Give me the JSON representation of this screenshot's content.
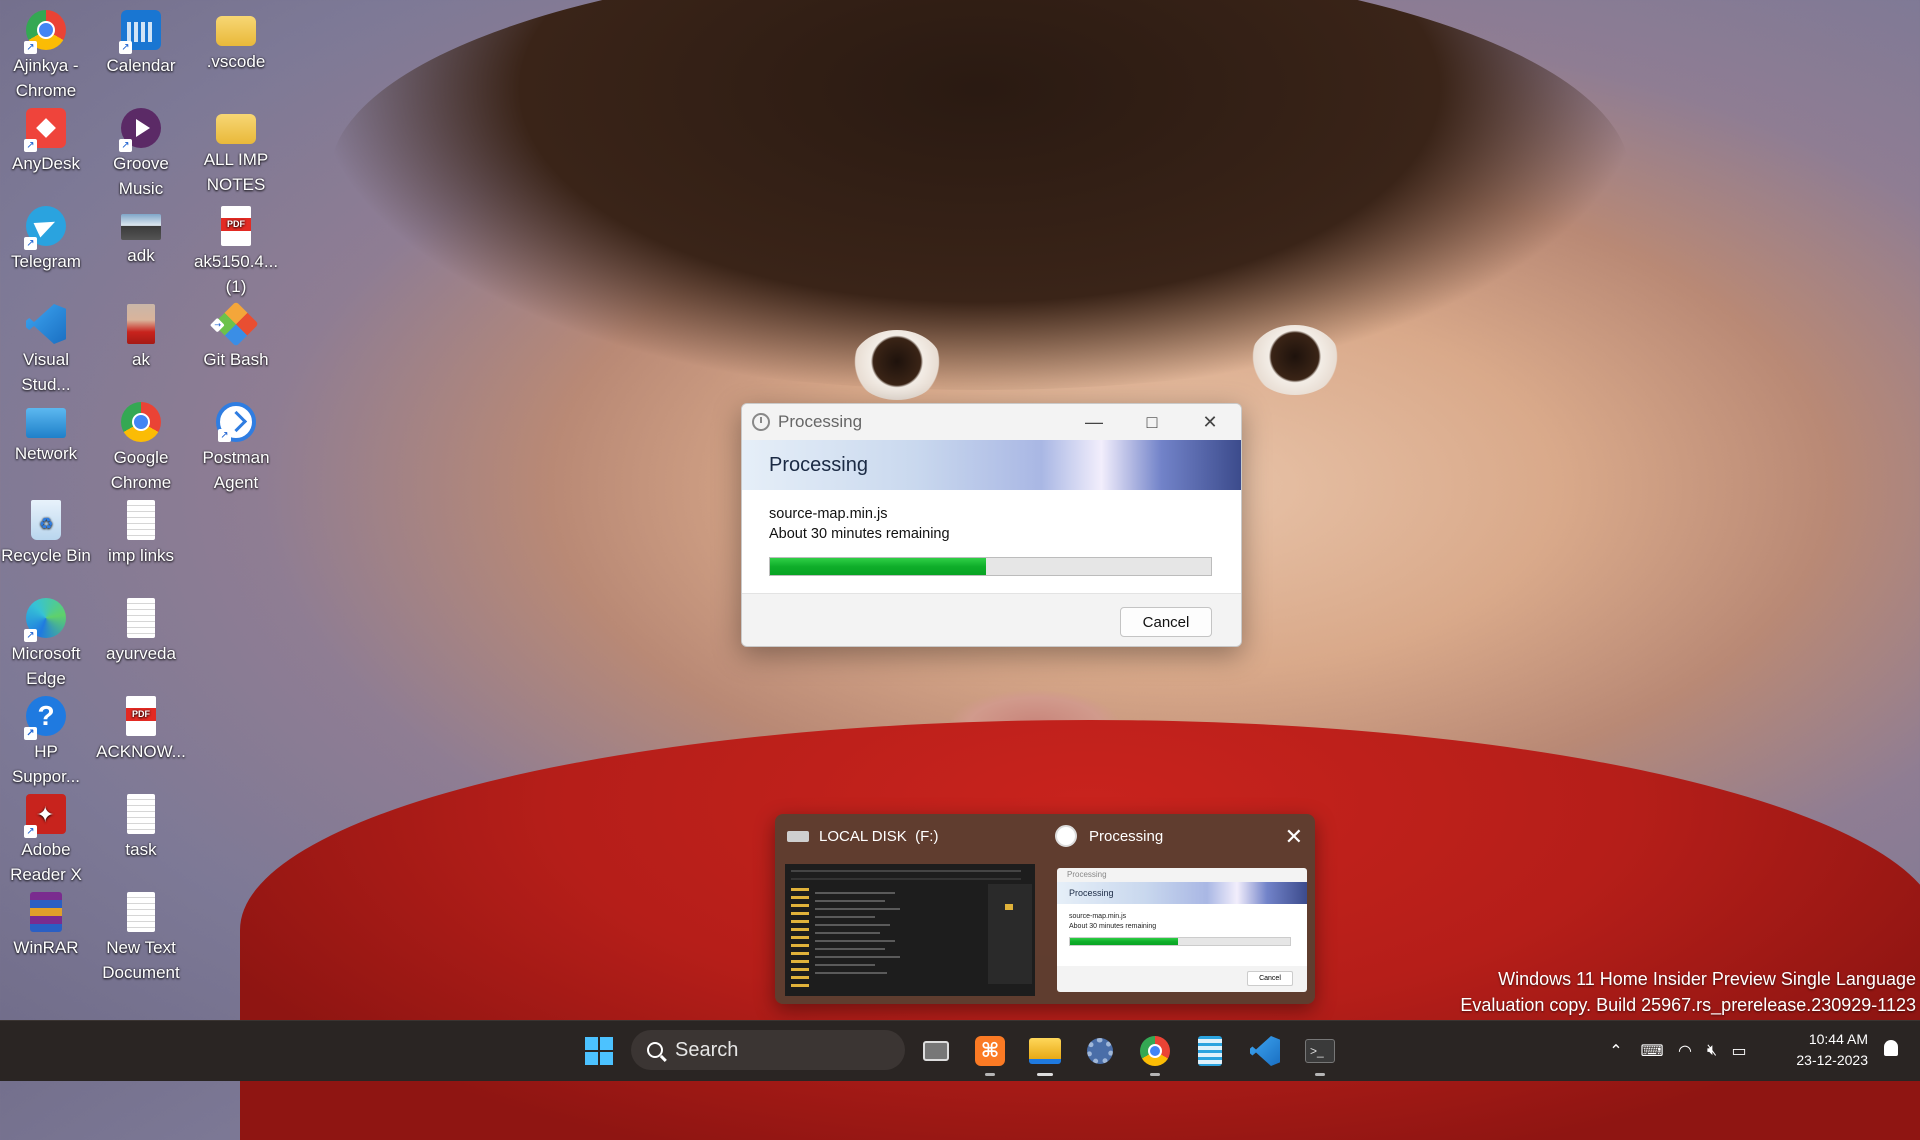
{
  "desktop": {
    "icons": [
      {
        "label": "Ajinkya - Chrome"
      },
      {
        "label": "Calendar"
      },
      {
        "label": ".vscode"
      },
      {
        "label": "AnyDesk"
      },
      {
        "label": "Groove Music"
      },
      {
        "label": "ALL IMP NOTES"
      },
      {
        "label": "Telegram"
      },
      {
        "label": "adk"
      },
      {
        "label": "ak5150.4... (1)"
      },
      {
        "label": "Visual Stud..."
      },
      {
        "label": "ak"
      },
      {
        "label": "Git Bash"
      },
      {
        "label": "Network"
      },
      {
        "label": "Google Chrome"
      },
      {
        "label": "Postman Agent"
      },
      {
        "label": "Recycle Bin"
      },
      {
        "label": "imp links"
      },
      {
        "label": "Microsoft Edge"
      },
      {
        "label": "ayurveda"
      },
      {
        "label": "HP Suppor..."
      },
      {
        "label": "ACKNOW..."
      },
      {
        "label": "Adobe Reader X"
      },
      {
        "label": "task"
      },
      {
        "label": "WinRAR"
      },
      {
        "label": "New Text Document"
      }
    ]
  },
  "dialog": {
    "window_title": "Processing",
    "banner_title": "Processing",
    "file_name": "source-map.min.js",
    "time_remaining": "About 30 minutes remaining",
    "progress_fraction": 0.49,
    "cancel_label": "Cancel",
    "colors": {
      "progress": "#0fae2a",
      "accent": "#3c4b8c"
    }
  },
  "taskbar_preview": {
    "items": [
      {
        "title": "LOCAL DISK  (F:)"
      },
      {
        "title": "Processing",
        "mini_file": "source-map.min.js",
        "mini_time": "About 30 minutes remaining",
        "mini_cancel": "Cancel"
      }
    ]
  },
  "watermark": {
    "line1": "Windows 11 Home Insider Preview Single Language",
    "line2": "Evaluation copy. Build 25967.rs_prerelease.230929-1123"
  },
  "taskbar": {
    "search_placeholder": "Search",
    "time": "10:44 AM",
    "date": "23-12-2023"
  }
}
